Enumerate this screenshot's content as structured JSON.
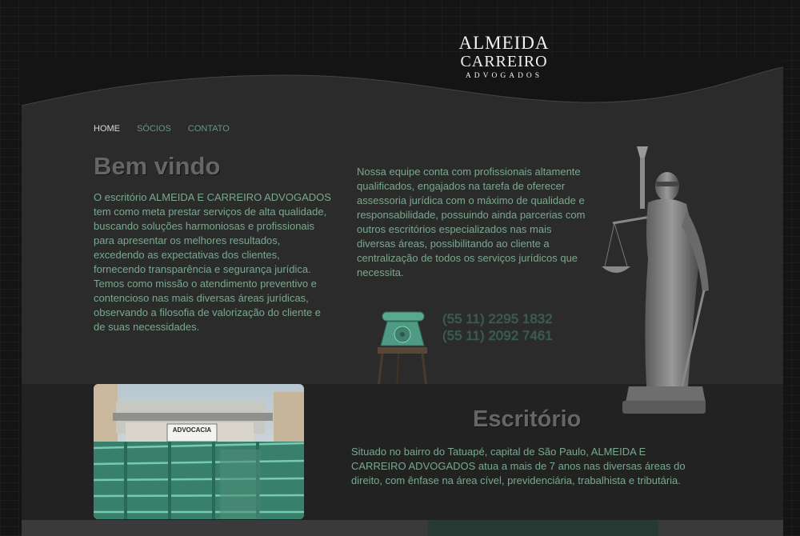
{
  "logo": {
    "line1": "ALMEIDA",
    "line2": "CARREIRO",
    "line3": "ADVOGADOS"
  },
  "nav": {
    "items": [
      "HOME",
      "SÓCIOS",
      "CONTATO"
    ],
    "active": "HOME"
  },
  "welcome": {
    "title": "Bem vindo",
    "text": "O escritório ALMEIDA E CARREIRO ADVOGADOS tem como meta prestar serviços de alta qualidade, buscando soluções harmoniosas e profissionais para apresentar os melhores resultados, excedendo as expectativas dos clientes, fornecendo transparência e segurança jurídica. Temos como missão o atendimento preventivo e contencioso nas mais diversas áreas jurídicas, observando a filosofia de valorização do cliente e de suas necessidades."
  },
  "team": {
    "text": "Nossa equipe conta com profissionais altamente qualificados, engajados na tarefa de oferecer assessoria jurídica com o máximo de qualidade e responsabilidade, possuindo ainda parcerias com outros escritórios especializados nas mais diversas áreas, possibilitando ao cliente a centralização de todos os serviços jurídicos que necessita."
  },
  "contact": {
    "phones": [
      "(55 11) 2295 1832",
      "(55 11) 2092 7461"
    ]
  },
  "office": {
    "title": "Escritório",
    "text": "Situado no bairro do Tatuapé, capital de São Paulo, ALMEIDA E CARREIRO ADVOGADOS atua a mais de 7 anos nas diversas áreas do direito, com ênfase na área cível, previdenciária, trabalhista e tributária.",
    "sign_text": "ADVOCACIA"
  },
  "icons": {
    "phone": "telephone-icon",
    "statue": "lady-justice-statue"
  },
  "colors": {
    "accent": "#5d9a84",
    "text": "#7aa88e",
    "phone_text": "#365e50",
    "panel": "#2b2b2b"
  }
}
